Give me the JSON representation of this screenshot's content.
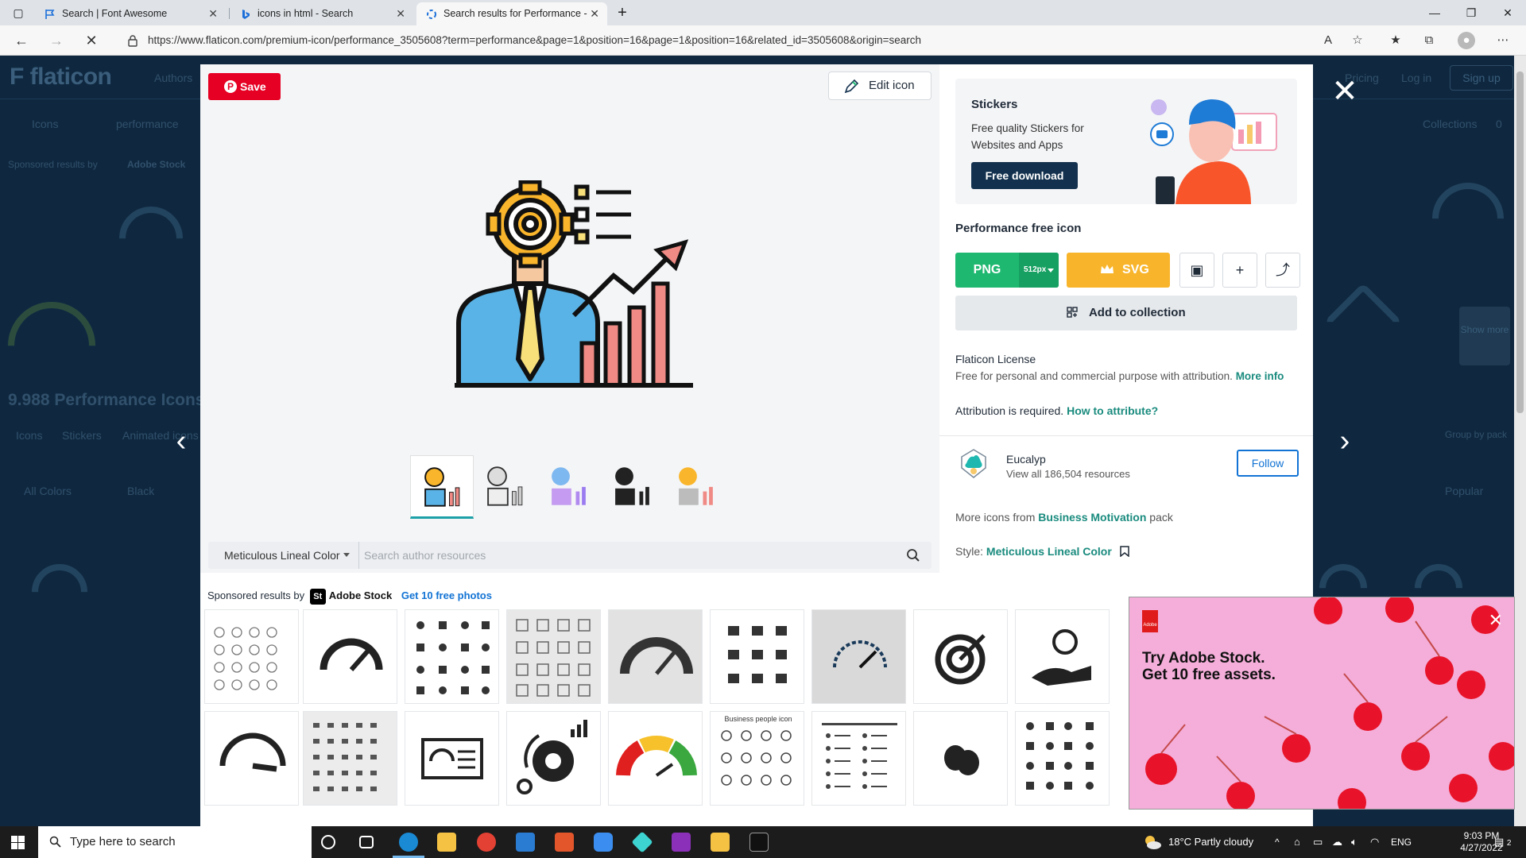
{
  "browser": {
    "tabs": [
      {
        "title": "Search | Font Awesome",
        "active": false
      },
      {
        "title": "icons in html - Search",
        "active": false
      },
      {
        "title": "Search results for Performance -",
        "active": true
      }
    ],
    "url": "https://www.flaticon.com/premium-icon/performance_3505608?term=performance&page=1&position=16&page=1&position=16&related_id=3505608&origin=search"
  },
  "background": {
    "logo": "flaticon",
    "nav": [
      "Authors",
      "Pricing",
      "Log in",
      "Sign up"
    ],
    "search_category": "Icons",
    "search_value": "performance",
    "collections_label": "Collections",
    "collections_count": "0",
    "sponsored_by": "Sponsored results by",
    "sponsor": "Adobe Stock",
    "results_heading": "9.988 Performance Icons",
    "tabs": [
      "Icons",
      "Stickers",
      "Animated icons"
    ],
    "filters": [
      "All Colors",
      "Black"
    ],
    "sort": "Popular",
    "group_by": "Group by pack",
    "show_more": "Show more"
  },
  "modal": {
    "save_label": "Save",
    "edit_label": "Edit icon",
    "author_search": {
      "style": "Meticulous Lineal Color",
      "placeholder": "Search author resources"
    },
    "sponsored": {
      "prefix": "Sponsored results by",
      "brand": "Adobe Stock",
      "cta": "Get 10 free photos"
    },
    "stickers": {
      "title": "Stickers",
      "desc": "Free quality Stickers for Websites and Apps",
      "button": "Free download"
    },
    "icon_title": "Performance free icon",
    "png": {
      "label": "PNG",
      "size": "512px"
    },
    "svg": {
      "label": "SVG"
    },
    "collection": "Add to collection",
    "license": {
      "title": "Flaticon License",
      "desc": "Free for personal and commercial purpose with attribution.",
      "more": "More info"
    },
    "attribution": {
      "text": "Attribution is required.",
      "link": "How to attribute?"
    },
    "author": {
      "name": "Eucalyp",
      "resources": "View all 186,504 resources",
      "follow": "Follow"
    },
    "more_from": {
      "prefix": "More icons from",
      "pack": "Business Motivation",
      "suffix": "pack"
    },
    "style": {
      "label": "Style:",
      "value": "Meticulous Lineal Color"
    }
  },
  "ad": {
    "brand": "Adobe",
    "headline_1": "Try Adobe Stock.",
    "headline_2": "Get 10 free assets."
  },
  "taskbar": {
    "search_placeholder": "Type here to search",
    "weather": "18°C  Partly cloudy",
    "lang": "ENG",
    "time": "9:03 PM",
    "date": "4/27/2022",
    "notifications": "2"
  },
  "colors": {
    "accent_green": "#1fb871",
    "svg_orange": "#f8b52b",
    "link_teal": "#1a8b7e",
    "pinterest_red": "#e60023",
    "overlay_navy": "#0f2840"
  }
}
